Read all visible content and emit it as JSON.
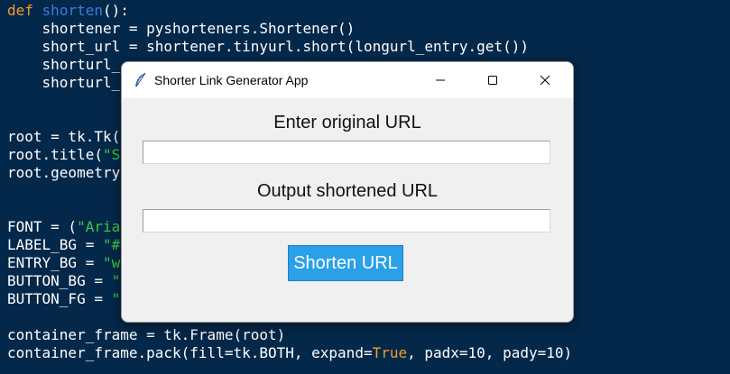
{
  "code": {
    "line1": {
      "kw": "def",
      "fn": "shorten",
      "rest": "():"
    },
    "line2": "    shortener = pyshorteners.Shortener()",
    "line3": "    short_url = shortener.tinyurl.short(longurl_entry.get())",
    "line4": "    shorturl_",
    "line5": "    shorturl_",
    "line6": "root = tk.Tk(",
    "line7a": "root.title(",
    "line7b": "\"S",
    "line8": "root.geometry",
    "line9a": "FONT = (",
    "line9b": "\"Aria",
    "line10a": "LABEL_BG = ",
    "line10b": "\"#",
    "line11a": "ENTRY_BG = ",
    "line11b": "\"w",
    "line12a": "BUTTON_BG = ",
    "line12b": "\"",
    "line13a": "BUTTON_FG = ",
    "line13b": "\"",
    "line14": "container_frame = tk.Frame(root)",
    "line15a": "container_frame.pack(fill=tk.BOTH, expand=",
    "line15b": "True",
    "line15c": ", padx=10, pady=10)"
  },
  "window": {
    "title": "Shorter Link Generator App",
    "icon": "feather-icon",
    "controls": [
      "minimize-icon",
      "maximize-icon",
      "close-icon"
    ]
  },
  "form": {
    "input_label": "Enter original URL",
    "input_value": "",
    "output_label": "Output shortened URL",
    "output_value": "",
    "button_label": "Shorten URL"
  },
  "colors": {
    "editor_bg": "#04284a",
    "keyword": "#f39c2a",
    "function": "#3d7dd8",
    "string": "#3fc93f",
    "button_bg": "#2aa0e8",
    "button_fg": "#ffffff"
  }
}
